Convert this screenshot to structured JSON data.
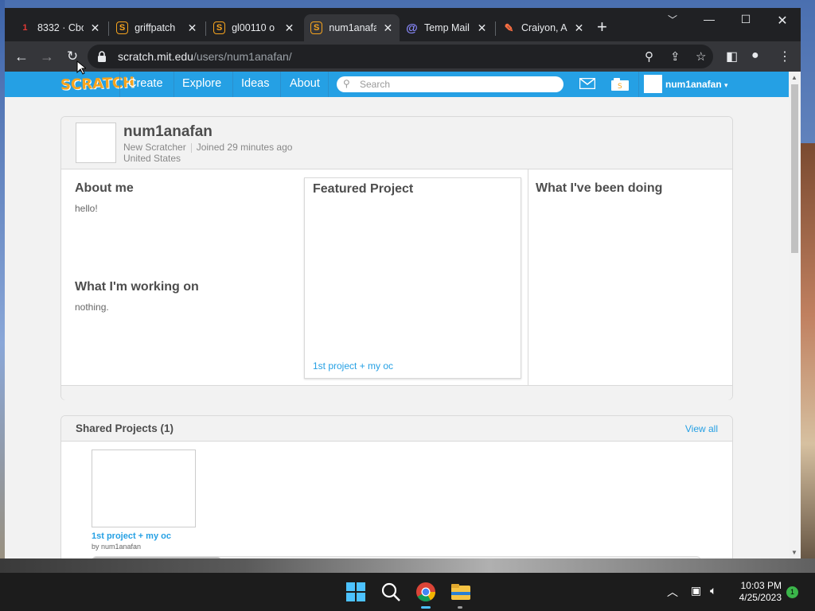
{
  "browser": {
    "tabs": [
      {
        "title": "8332 · Cbc",
        "favicon": "1"
      },
      {
        "title": "griffpatch",
        "favicon": "S"
      },
      {
        "title": "gl00110 o",
        "favicon": "S"
      },
      {
        "title": "num1anafa",
        "favicon": "S"
      },
      {
        "title": "Temp Mail",
        "favicon": "@"
      },
      {
        "title": "Craiyon, A",
        "favicon": "✎"
      }
    ],
    "new_tab": "+",
    "url_host": "scratch.mit.edu",
    "url_path": "/users/num1anafan/"
  },
  "scratch_nav": {
    "logo": "SCRATCH",
    "links": [
      "Create",
      "Explore",
      "Ideas",
      "About"
    ],
    "search_placeholder": "Search",
    "username": "num1anafan",
    "username_caret": "▾"
  },
  "profile": {
    "username": "num1anafan",
    "role": "New Scratcher",
    "joined": "Joined 29 minutes ago",
    "country": "United States",
    "about_title": "About me",
    "about_text": "hello!",
    "working_title": "What I'm working on",
    "working_text": "nothing.",
    "featured_title": "Featured Project",
    "featured_link": "1st project + my oc",
    "doing_title": "What I've been doing"
  },
  "shared": {
    "title": "Shared Projects (1)",
    "view_all": "View all",
    "projects": [
      {
        "title": "1st project + my oc",
        "by": "by num1anafan"
      }
    ]
  },
  "taskbar": {
    "time": "10:03 PM",
    "date": "4/25/2023",
    "notifications": "1"
  },
  "colors": {
    "scratch_blue": "#25a0e4",
    "chrome_dark": "#202124"
  }
}
